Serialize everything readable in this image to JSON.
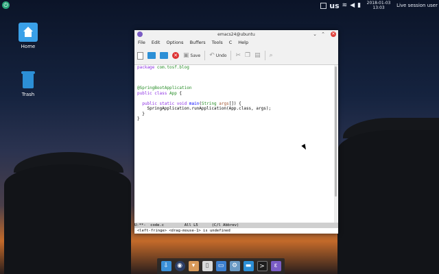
{
  "top_panel": {
    "keyboard_layout": "us",
    "date": "2018-01-03",
    "time": "13:03",
    "session_user": "Live session user"
  },
  "desktop": {
    "icons": [
      {
        "label": "Home"
      },
      {
        "label": "Trash"
      }
    ]
  },
  "window": {
    "title": "emacs24@ubuntu",
    "menu": [
      "File",
      "Edit",
      "Options",
      "Buffers",
      "Tools",
      "C",
      "Help"
    ],
    "toolbar": {
      "save_label": "Save",
      "undo_label": "Undo"
    },
    "code": {
      "line1_kw": "package",
      "line1_pk": " com.tosf.blog",
      "annotation": "@SpringBootApplication",
      "class_kw": "public class",
      "class_name": " App",
      "class_rest": " {",
      "main_kw": "public static void",
      "main_fn": " main",
      "main_open": "(",
      "main_ty": "String",
      "main_var": " args",
      "main_close": "[]) {",
      "call": "SpringApplication.runApplication(App.class, args);",
      "close_inner": "  }",
      "close_outer": "}"
    },
    "modeline": "U:**-  code.c         All L5      (C/l Abbrev)",
    "echo": "<left-fringe> <drag-mouse-1> is undefined"
  },
  "dock": {
    "items": [
      "downloads-icon",
      "browser-icon",
      "software-icon",
      "files-icon",
      "display-icon",
      "settings-icon",
      "folder-icon",
      "terminal-icon",
      "emacs-icon"
    ]
  }
}
